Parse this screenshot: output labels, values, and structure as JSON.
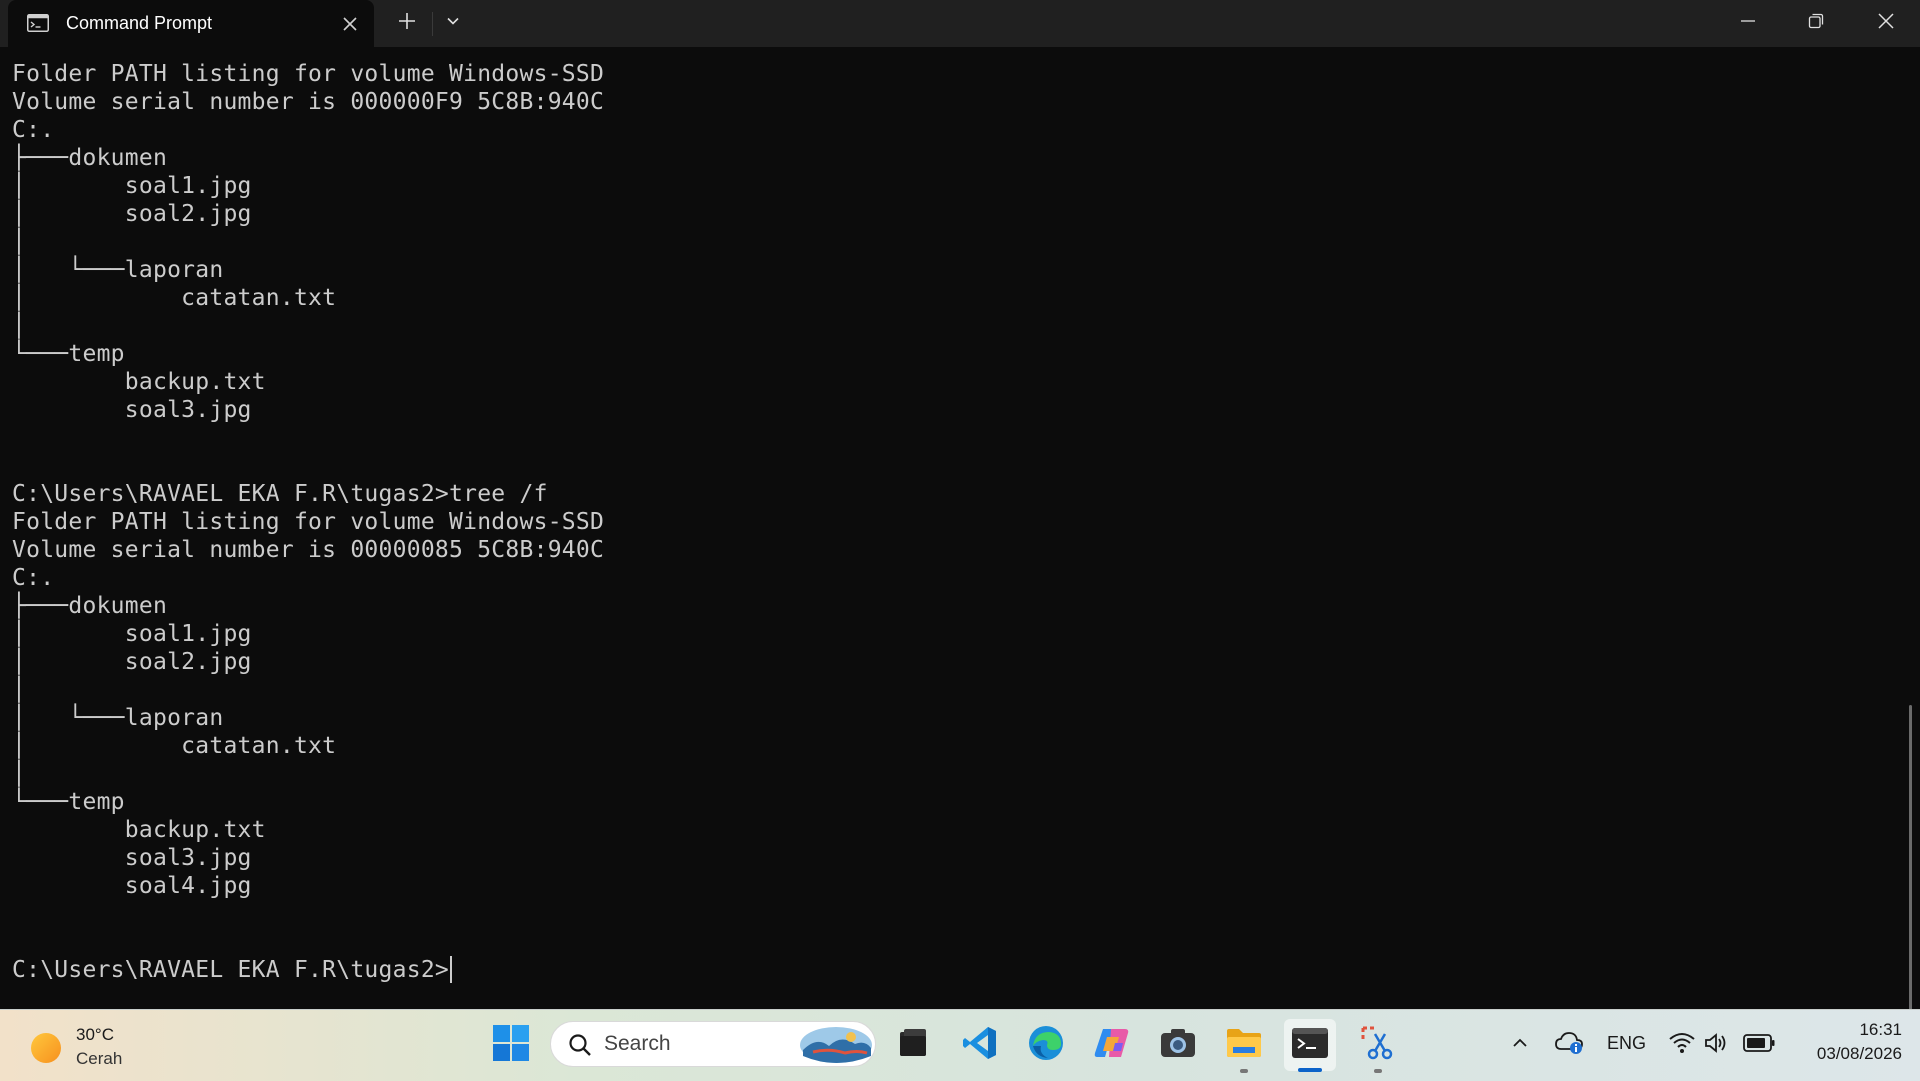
{
  "window": {
    "tab_title": "Command Prompt",
    "new_tab_label": "+",
    "icons": [
      "terminal-icon",
      "close-icon",
      "plus-icon",
      "chevron-down-icon",
      "minimize-icon",
      "restore-icon",
      "close-icon"
    ]
  },
  "terminal": {
    "output": "Folder PATH listing for volume Windows-SSD\nVolume serial number is 000000F9 5C8B:940C\nC:.\n├───dokumen\n│       soal1.jpg\n│       soal2.jpg\n│       \n│   └───laporan\n│           catatan.txt\n│           \n└───temp\n        backup.txt\n        soal3.jpg\n        \n\nC:\\Users\\RAVAEL EKA F.R\\tugas2>tree /f\nFolder PATH listing for volume Windows-SSD\nVolume serial number is 00000085 5C8B:940C\nC:.\n├───dokumen\n│       soal1.jpg\n│       soal2.jpg\n│       \n│   └───laporan\n│           catatan.txt\n│           \n└───temp\n        backup.txt\n        soal3.jpg\n        soal4.jpg\n        \n\n",
    "prompt": "C:\\Users\\RAVAEL EKA F.R\\tugas2>",
    "colors": {
      "background": "#0c0c0c",
      "text": "#cccccc"
    }
  },
  "taskbar": {
    "weather": {
      "temp": "30°C",
      "desc": "Cerah"
    },
    "search_placeholder": "Search",
    "apps": [
      "start-icon",
      "file-manager-icon",
      "vscode-icon",
      "edge-icon",
      "copilot-icon",
      "camera-icon",
      "file-explorer-icon",
      "terminal-icon",
      "snipping-tool-icon"
    ],
    "tray": {
      "language": "ENG",
      "time": "16:31",
      "date": "03/08/2026"
    }
  }
}
